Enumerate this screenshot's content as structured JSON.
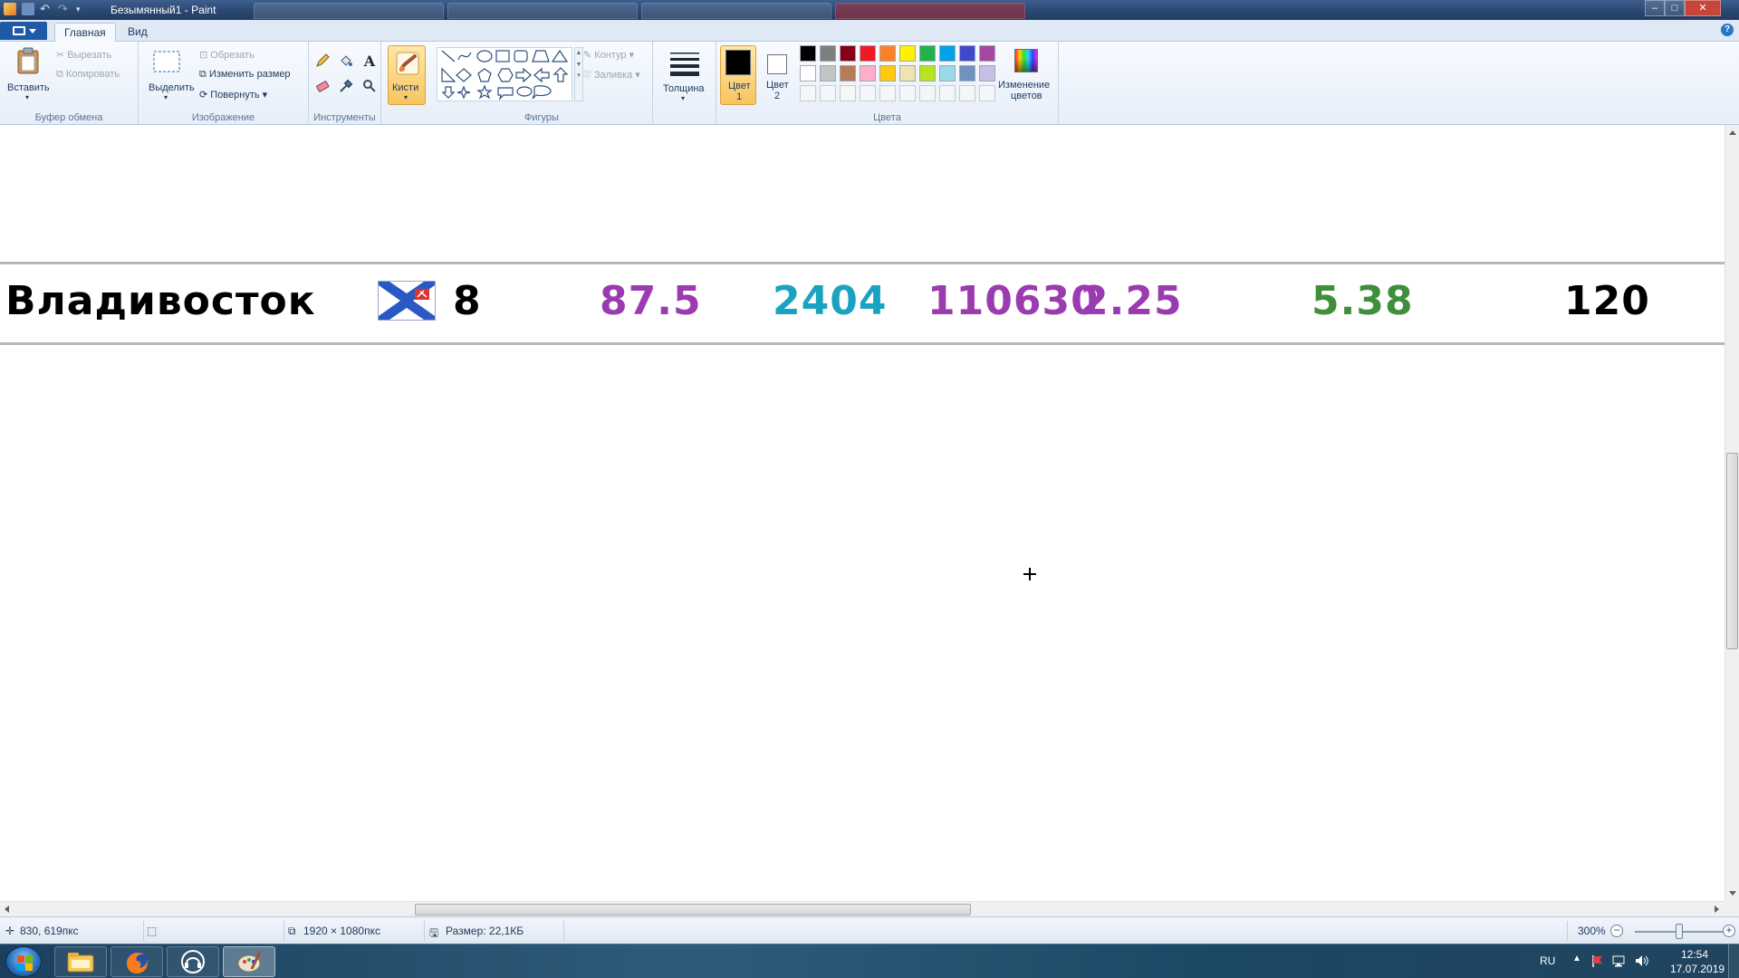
{
  "window": {
    "title": "Безымянный1 - Paint",
    "controls": {
      "minimize": "–",
      "maximize": "□",
      "close": "✕"
    }
  },
  "menu_tabs": {
    "home": "Главная",
    "view": "Вид",
    "help_icon": "?"
  },
  "ribbon": {
    "clipboard": {
      "group_label": "Буфер обмена",
      "paste": "Вставить",
      "cut": "Вырезать",
      "copy": "Копировать"
    },
    "image": {
      "group_label": "Изображение",
      "select": "Выделить",
      "crop": "Обрезать",
      "resize": "Изменить размер",
      "rotate": "Повернуть"
    },
    "tools": {
      "group_label": "Инструменты",
      "text_tool": "A"
    },
    "brushes": {
      "label": "Кисти"
    },
    "shapes": {
      "group_label": "Фигуры",
      "outline": "Контур",
      "fill": "Заливка"
    },
    "size": {
      "label": "Толщина"
    },
    "colors": {
      "group_label": "Цвета",
      "color1": "Цвет 1",
      "color1_line1": "Цвет",
      "color1_line2": "1",
      "color2_line1": "Цвет",
      "color2_line2": "2",
      "edit_colors_line1": "Изменение",
      "edit_colors_line2": "цветов",
      "color1_value": "#000000",
      "color2_value": "#ffffff",
      "palette_row1": [
        "#000000",
        "#7f7f7f",
        "#880015",
        "#ed1c24",
        "#ff7f27",
        "#fff200",
        "#22b14c",
        "#00a2e8",
        "#3f48cc",
        "#a349a4"
      ],
      "palette_row2": [
        "#ffffff",
        "#c3c3c3",
        "#b97a57",
        "#ffaec9",
        "#ffc90e",
        "#efe4b0",
        "#b5e61d",
        "#99d9ea",
        "#7092be",
        "#c8bfe7"
      ]
    }
  },
  "canvas": {
    "row": {
      "city": "Владивосток",
      "flag_icon": "naval-ensign-icon",
      "col1": "8",
      "col2": "87.5",
      "col3": "2404",
      "col4": "110630",
      "col5": "2.25",
      "col6": "5.38",
      "col7": "120"
    },
    "colors": {
      "city": "#000000",
      "col1": "#000000",
      "col2": "#9b3bb0",
      "col3": "#1aa3c1",
      "col4": "#9b3bb0",
      "col5": "#9b3bb0",
      "col6": "#3f8f3a",
      "col7": "#000000"
    }
  },
  "statusbar": {
    "cursor_pos": "830, 619пкс",
    "image_size": "1920 × 1080пкс",
    "file_size": "Размер: 22,1КБ",
    "zoom": "300%"
  },
  "taskbar": {
    "apps": [
      "explorer-icon",
      "firefox-icon",
      "headset-icon",
      "paint-icon"
    ],
    "language": "RU",
    "time": "12:54",
    "date": "17.07.2019"
  }
}
